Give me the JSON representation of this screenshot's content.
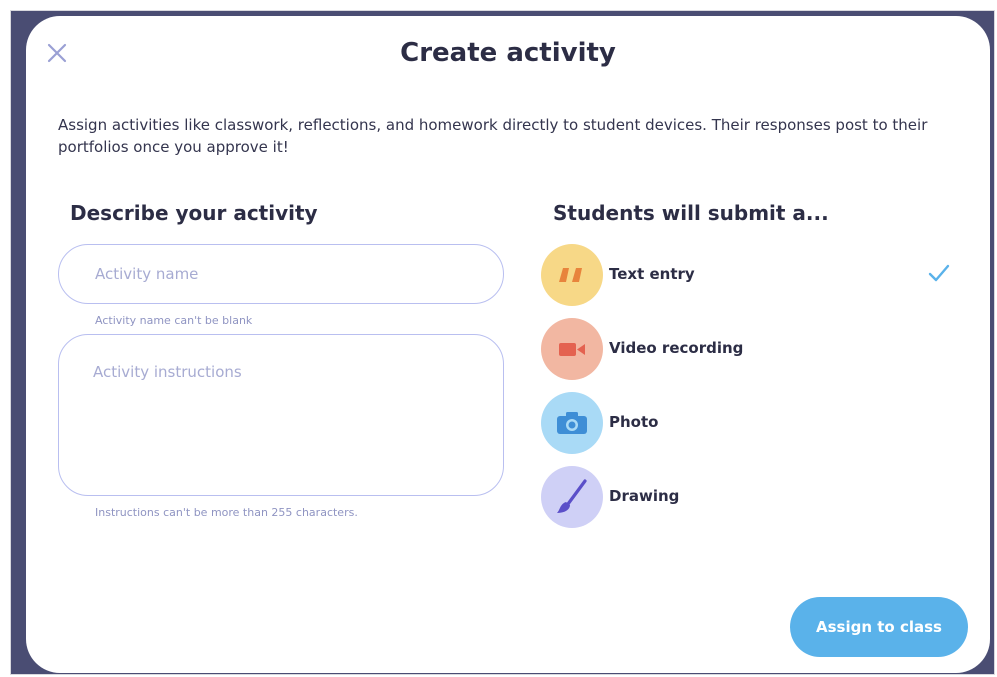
{
  "modal": {
    "title": "Create activity",
    "description": "Assign activities like classwork, reflections, and homework directly to student devices. Their responses post to their portfolios once you approve it!",
    "close_icon": "close-icon"
  },
  "describe": {
    "heading": "Describe your activity",
    "name_placeholder": "Activity name",
    "name_value": "",
    "name_hint": "Activity name can't be blank",
    "instructions_placeholder": "Activity instructions",
    "instructions_value": "",
    "instructions_hint": "Instructions can't be more than 255 characters."
  },
  "submit": {
    "heading": "Students will submit a...",
    "options": [
      {
        "label": "Text entry",
        "icon": "quote-icon",
        "selected": true,
        "color": "#f7d887",
        "icon_color": "#e8843c"
      },
      {
        "label": "Video recording",
        "icon": "video-icon",
        "selected": false,
        "color": "#f2b7a2",
        "icon_color": "#e46250"
      },
      {
        "label": "Photo",
        "icon": "camera-icon",
        "selected": false,
        "color": "#a9daf6",
        "icon_color": "#3e8ed6"
      },
      {
        "label": "Drawing",
        "icon": "paintbrush-icon",
        "selected": false,
        "color": "#cfd0f6",
        "icon_color": "#5b4fc9"
      }
    ],
    "check_icon": "check-icon"
  },
  "footer": {
    "assign_label": "Assign to class"
  },
  "colors": {
    "backdrop": "#4a4d73",
    "primary": "#5ab2ea",
    "text": "#2c2d45",
    "input_border": "#b9bff0",
    "hint": "#8f94c2"
  }
}
